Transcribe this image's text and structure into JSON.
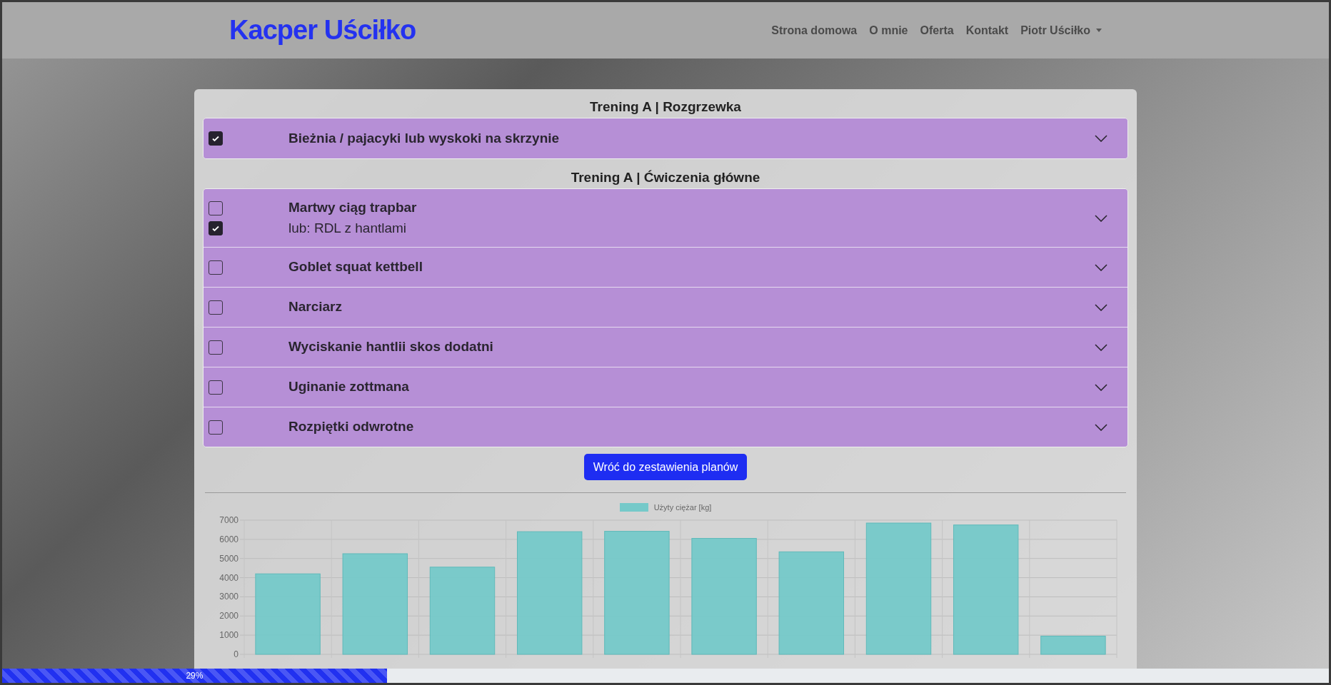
{
  "brand": "Kacper Uściłko",
  "nav": [
    {
      "label": "Strona domowa",
      "dropdown": false
    },
    {
      "label": "O mnie",
      "dropdown": false
    },
    {
      "label": "Oferta",
      "dropdown": false
    },
    {
      "label": "Kontakt",
      "dropdown": false
    },
    {
      "label": "Piotr Uściłko",
      "dropdown": true
    }
  ],
  "sections": [
    {
      "title": "Trening A | Rozgrzewka",
      "exercises": [
        {
          "name": "Bieżnia / pajacyki lub wyskoki na skrzynie",
          "checked": true
        }
      ]
    },
    {
      "title": "Trening A | Ćwiczenia główne",
      "exercises": [
        {
          "name": "Martwy ciąg trapbar",
          "checked": false,
          "alternatives": [
            {
              "name": "lub: RDL z hantlami",
              "checked": true
            }
          ]
        },
        {
          "name": "Goblet squat kettbell",
          "checked": false
        },
        {
          "name": "Narciarz",
          "checked": false
        },
        {
          "name": "Wyciskanie hantlii skos dodatni",
          "checked": false
        },
        {
          "name": "Uginanie zottmana",
          "checked": false
        },
        {
          "name": "Rozpiętki odwrotne",
          "checked": false
        }
      ]
    }
  ],
  "back_button": "Wróć do zestawienia planów",
  "chart": {
    "chart_data": {
      "type": "bar",
      "grid": true,
      "series": [
        {
          "name": "Użyty ciężar [kg]",
          "color": "#75c9c9",
          "values": [
            4200,
            5250,
            4550,
            6400,
            6420,
            6050,
            5350,
            6850,
            6750,
            950
          ]
        }
      ],
      "ylim": [
        0,
        7000
      ],
      "yticks": [
        0,
        1000,
        2000,
        3000,
        4000,
        5000,
        6000,
        7000
      ]
    }
  },
  "progress": {
    "label": "29%",
    "level": 0.29
  }
}
